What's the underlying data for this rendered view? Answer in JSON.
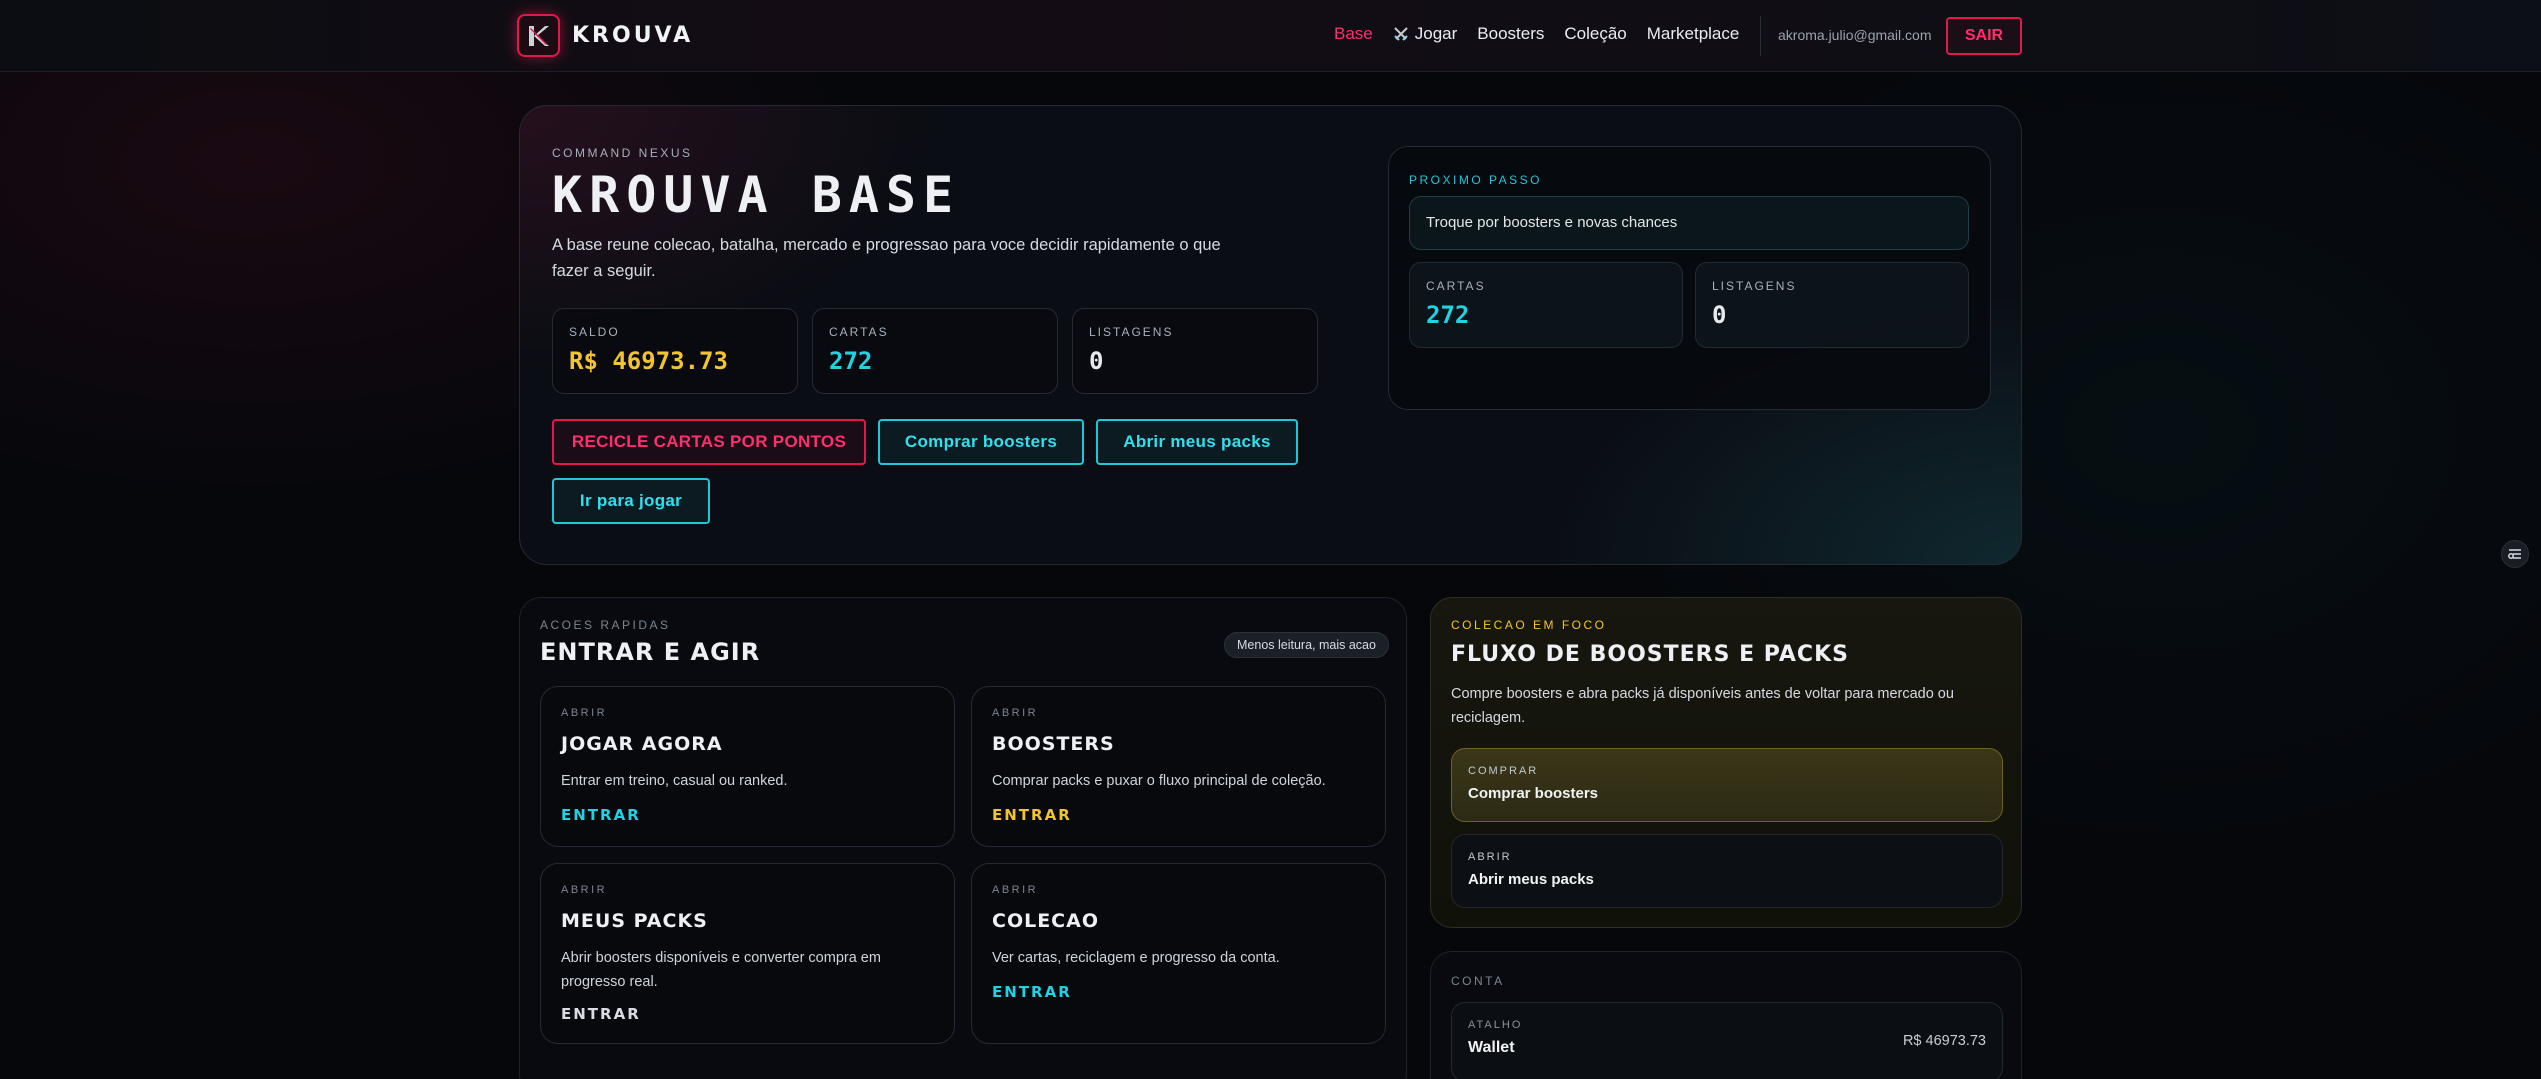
{
  "nav": {
    "brand": "KROUVA",
    "links": [
      "Base",
      "Jogar",
      "Boosters",
      "Coleção",
      "Marketplace"
    ],
    "email": "akroma.julio@gmail.com",
    "logout": "SAIR"
  },
  "hero": {
    "eyebrow": "COMMAND NEXUS",
    "title": "KROUVA BASE",
    "subtitle": "A base reune colecao, batalha, mercado e progressao para voce decidir rapidamente o que fazer a seguir.",
    "stats": [
      {
        "label": "SALDO",
        "value": "R$ 46973.73"
      },
      {
        "label": "CARTAS",
        "value": "272"
      },
      {
        "label": "LISTAGENS",
        "value": "0"
      }
    ],
    "buttons": {
      "recycle": "RECICLE CARTAS POR PONTOS",
      "buy": "Comprar boosters",
      "open": "Abrir meus packs",
      "play": "Ir para jogar"
    },
    "next": {
      "eyebrow": "PROXIMO PASSO",
      "text": "Troque por boosters e novas chances",
      "stats": [
        {
          "label": "CARTAS",
          "value": "272"
        },
        {
          "label": "LISTAGENS",
          "value": "0"
        }
      ]
    }
  },
  "quick": {
    "eyebrow": "ACOES RAPIDAS",
    "title": "ENTRAR E AGIR",
    "pill": "Menos leitura, mais acao",
    "cards": [
      {
        "eyebrow": "ABRIR",
        "title": "JOGAR AGORA",
        "desc": "Entrar em treino, casual ou ranked.",
        "link": "ENTRAR"
      },
      {
        "eyebrow": "ABRIR",
        "title": "BOOSTERS",
        "desc": "Comprar packs e puxar o fluxo principal de coleção.",
        "link": "ENTRAR"
      },
      {
        "eyebrow": "ABRIR",
        "title": "MEUS PACKS",
        "desc": "Abrir boosters disponíveis e converter compra em progresso real.",
        "link": "ENTRAR"
      },
      {
        "eyebrow": "ABRIR",
        "title": "COLECAO",
        "desc": "Ver cartas, reciclagem e progresso da conta.",
        "link": "ENTRAR"
      }
    ]
  },
  "focus": {
    "eyebrow": "COLECAO EM FOCO",
    "title": "FLUXO DE BOOSTERS E PACKS",
    "desc": "Compre boosters e abra packs já disponíveis antes de voltar para mercado ou reciclagem.",
    "actions": [
      {
        "eyebrow": "COMPRAR",
        "label": "Comprar boosters"
      },
      {
        "eyebrow": "ABRIR",
        "label": "Abrir meus packs"
      }
    ]
  },
  "account": {
    "eyebrow": "CONTA",
    "wallet": {
      "eyebrow": "ATALHO",
      "label": "Wallet",
      "amount": "R$ 46973.73"
    }
  },
  "colors": {
    "accent_red": "#e0194a",
    "accent_cyan": "#20c7d8",
    "accent_yellow": "#f3c431"
  }
}
